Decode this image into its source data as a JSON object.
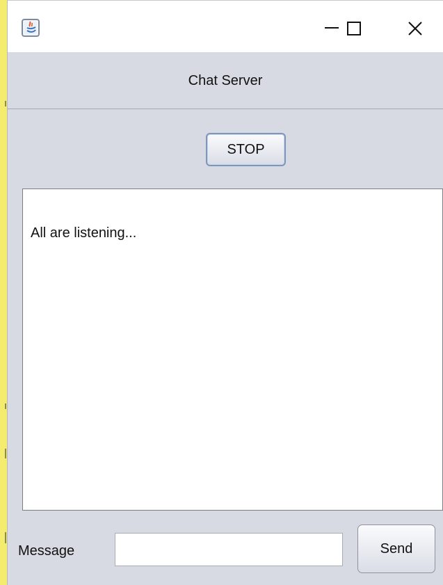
{
  "window": {
    "header_title": "Chat Server",
    "icons": {
      "app": "java-app-icon",
      "minimize": "minimize-icon",
      "maximize": "maximize-icon",
      "close": "close-icon"
    }
  },
  "controls": {
    "stop_label": "STOP"
  },
  "log": {
    "text": "All are listening..."
  },
  "message_bar": {
    "label": "Message",
    "input_value": "",
    "send_label": "Send"
  },
  "colors": {
    "panel_background": "#d7dae2",
    "screen_background": "#f4ec6e",
    "button_focus_border": "#7e96ba"
  }
}
